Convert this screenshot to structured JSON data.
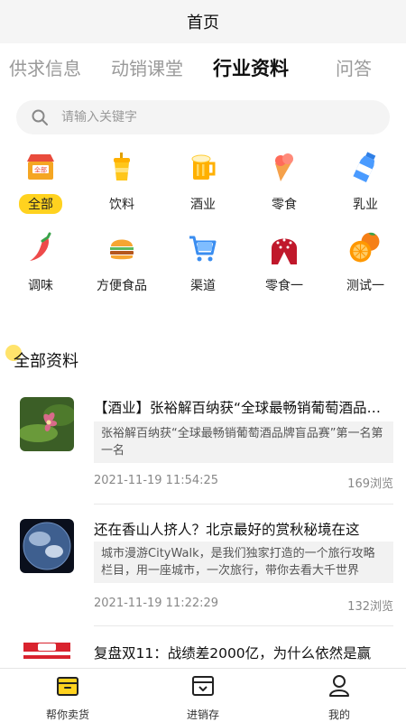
{
  "header": {
    "title": "首页"
  },
  "tabs": [
    {
      "label": "供求信息",
      "active": false
    },
    {
      "label": "动销课堂",
      "active": false
    },
    {
      "label": "行业资料",
      "active": true
    },
    {
      "label": "问答",
      "active": false
    }
  ],
  "search": {
    "placeholder": "请输入关键字"
  },
  "categories": [
    {
      "label": "全部",
      "icon": "store-icon",
      "selected": true
    },
    {
      "label": "饮料",
      "icon": "drink-cup-icon",
      "selected": false
    },
    {
      "label": "酒业",
      "icon": "beer-mug-icon",
      "selected": false
    },
    {
      "label": "零食",
      "icon": "ice-cream-icon",
      "selected": false
    },
    {
      "label": "乳业",
      "icon": "milk-bottle-icon",
      "selected": false
    },
    {
      "label": "调味",
      "icon": "chili-pepper-icon",
      "selected": false
    },
    {
      "label": "方便食品",
      "icon": "burger-icon",
      "selected": false
    },
    {
      "label": "渠道",
      "icon": "shopping-cart-icon",
      "selected": false
    },
    {
      "label": "零食一",
      "icon": "strawberry-badge-icon",
      "selected": false
    },
    {
      "label": "测试一",
      "icon": "orange-icon",
      "selected": false
    }
  ],
  "section": {
    "title": "全部资料"
  },
  "articles": [
    {
      "title": "【酒业】张裕解百纳获“全球最畅销葡萄酒品牌盲品赛”第一名第一名",
      "summary": "张裕解百纳获“全球最畅销葡萄酒品牌盲品赛”第一名第一名",
      "date": "2021-11-19 11:54:25",
      "views": "169浏览",
      "thumb": "orchid-photo"
    },
    {
      "title": "还在香山人挤人？北京最好的赏秋秘境在这",
      "summary": "城市漫游CityWalk，是我们独家打造的一个旅行攻略栏目，用一座城市，一次旅行，带你去看大千世界",
      "date": "2021-11-19 11:22:29",
      "views": "132浏览",
      "thumb": "earth-photo"
    },
    {
      "title": "复盘双11：战绩差2000亿，为什么依然是赢",
      "thumb": "tmall-banner"
    }
  ],
  "bottom_nav": [
    {
      "label": "帮你卖货",
      "icon": "box-icon",
      "active": true
    },
    {
      "label": "进销存",
      "icon": "inventory-icon",
      "active": false
    },
    {
      "label": "我的",
      "icon": "user-icon",
      "active": false
    }
  ],
  "colors": {
    "accent": "#ffd21f",
    "text": "#111111",
    "muted": "#9a9a9a"
  }
}
